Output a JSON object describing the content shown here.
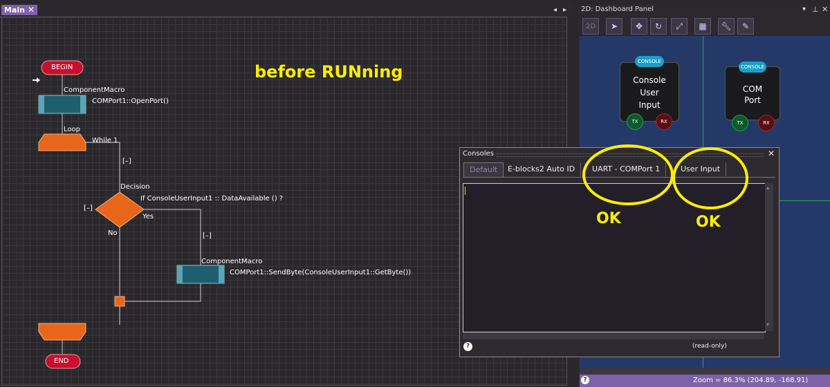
{
  "main": {
    "tab_label": "Main",
    "tab_close": "✕",
    "annotation": "before RUNning",
    "flow": {
      "begin": "BEGIN",
      "end": "END",
      "macro1_title": "ComponentMacro",
      "macro1_call": "COMPort1::OpenPort()",
      "loop_title": "Loop",
      "loop_cond": "While 1",
      "collapse1": "[–]",
      "decision_title": "Decision",
      "decision_cond": "If ConsoleUserInput1 :: DataAvailable () ?",
      "collapse_left": "[–]",
      "yes": "Yes",
      "no": "No",
      "collapse2": "[–]",
      "macro2_title": "ComponentMacro",
      "macro2_call": "COMPort1::SendByte(ConsoleUserInput1::GetByte())"
    }
  },
  "dashboard": {
    "title": "2D: Dashboard Panel",
    "toolbar_2d": "2D",
    "components": [
      {
        "badge": "CONSOLE",
        "label_lines": [
          "Console",
          "User",
          "Input"
        ],
        "tx": "TX",
        "rx": "RX"
      },
      {
        "badge": "CONSOLE",
        "label_lines": [
          "COM",
          "Port"
        ],
        "tx": "TX",
        "rx": "RX"
      }
    ],
    "status": "Zoom = 86.3% (204.89, -168.91)",
    "help": "?"
  },
  "consoles": {
    "title": "Consoles",
    "close": "✕",
    "tabs": [
      "Default",
      "E-blocks2 Auto ID",
      "UART - COMPort 1",
      "User Input"
    ],
    "readonly": "(read-only)",
    "help": "?",
    "ok1": "OK",
    "ok2": "OK"
  },
  "colors": {
    "accent": "#7e62a8",
    "terminator": "#c8102e",
    "macro": "#1e5e6e",
    "loop": "#e8661a",
    "highlight": "#ffee00",
    "dashboard_bg": "#253969"
  }
}
